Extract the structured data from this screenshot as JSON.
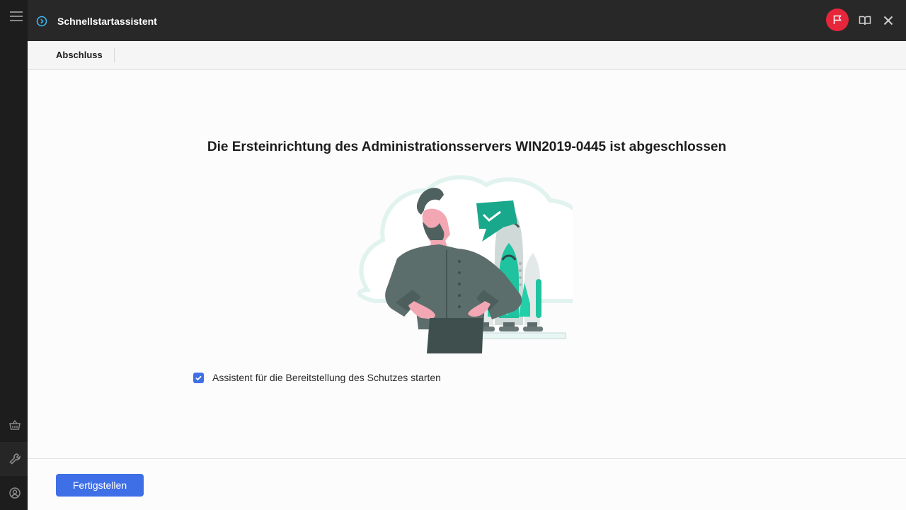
{
  "window": {
    "title": "Schnellstartassistent"
  },
  "steps": {
    "current": "Abschluss"
  },
  "main": {
    "headline": "Die Ersteinrichtung des Administrationsservers WIN2019-0445 ist abgeschlossen",
    "checkbox_label": "Assistent für die Bereitstellung des Schutzes starten",
    "checkbox_checked": true
  },
  "footer": {
    "finish_label": "Fertigstellen"
  },
  "icons": {
    "menu": "hamburger-icon",
    "basket": "basket-icon",
    "wrench": "wrench-icon",
    "account": "account-icon",
    "wizard": "play-circle-icon",
    "flag": "flag-icon",
    "book": "book-icon",
    "close": "close-icon"
  },
  "colors": {
    "accent": "#3f6fe6",
    "flag_button": "#e5263b",
    "titlebar": "#282828",
    "sidebar": "#1d1d1d",
    "illustration_green": "#1fc3a0"
  }
}
